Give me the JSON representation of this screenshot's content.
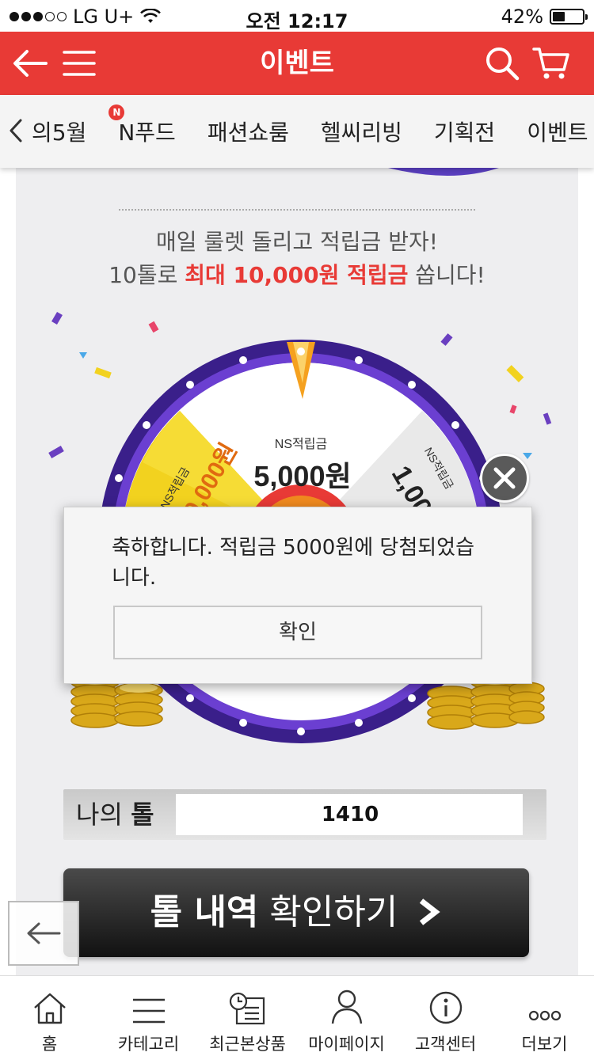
{
  "status_bar": {
    "carrier": "LG U+",
    "time": "오전 12:17",
    "battery_percent": "42%",
    "battery_level": 0.42
  },
  "header": {
    "title": "이벤트",
    "accent_color": "#e83a36"
  },
  "category_nav": {
    "items": [
      {
        "label": "의5월"
      },
      {
        "label": "N푸드",
        "badge": "N"
      },
      {
        "label": "패션쇼룸"
      },
      {
        "label": "헬씨리빙"
      },
      {
        "label": "기획전"
      },
      {
        "label": "이벤트"
      }
    ]
  },
  "promo": {
    "line1": "매일 룰렛 돌리고 적립금 받자!",
    "line2_prefix": "10톨로 ",
    "line2_highlight": "최대 10,000원 적립금",
    "line2_suffix": " 쏩니다!"
  },
  "wheel": {
    "segment_label": "NS적립금",
    "top_amount": "5,000원",
    "left_amount": "10,000원",
    "right_amount": "1,000"
  },
  "dialog": {
    "message": "축하합니다. 적립금 5000원에 당첨되었습니다.",
    "confirm_label": "확인"
  },
  "tol": {
    "label_prefix": "나의 ",
    "label_bold": "톨",
    "value": "1410"
  },
  "history_button": {
    "bold": "톨 내역",
    "rest": " 확인하기"
  },
  "tab_bar": {
    "items": [
      {
        "label": "홈",
        "icon": "home-icon"
      },
      {
        "label": "카테고리",
        "icon": "menu-icon"
      },
      {
        "label": "최근본상품",
        "icon": "recent-items-icon"
      },
      {
        "label": "마이페이지",
        "icon": "person-icon"
      },
      {
        "label": "고객센터",
        "icon": "info-icon"
      },
      {
        "label": "더보기",
        "icon": "more-icon"
      }
    ]
  }
}
